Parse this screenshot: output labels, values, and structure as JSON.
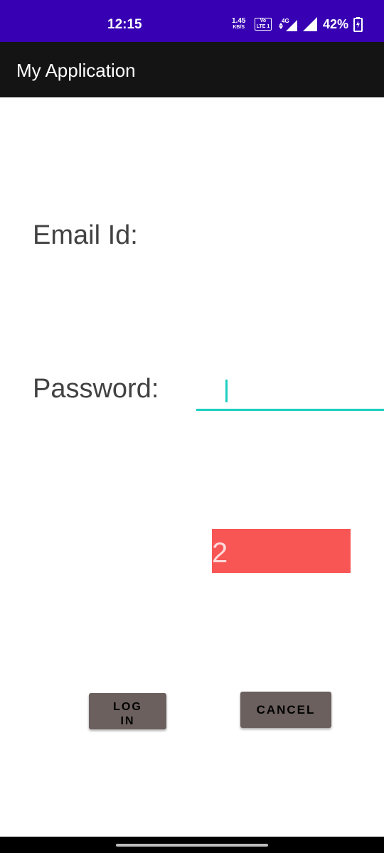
{
  "status_bar": {
    "time": "12:15",
    "net_speed_value": "1.45",
    "net_speed_unit": "KB/S",
    "volte_label": "Vo LTE 1",
    "network_label": "4G",
    "battery_percent": "42%",
    "background_color": "#3700b3"
  },
  "app_bar": {
    "title": "My Application",
    "background_color": "#141414"
  },
  "form": {
    "email_label": "Email Id:",
    "password_label": "Password:",
    "password_value": "",
    "accent_color": "#1ccfc0"
  },
  "red_box": {
    "text": "2",
    "color": "#f85555"
  },
  "buttons": {
    "login": "LOGIN",
    "cancel": "CANCEL",
    "color": "#6b605e"
  },
  "icons": {
    "volte": "volte-icon",
    "signal_4g": "signal-4g-icon",
    "signal": "signal-icon",
    "battery": "battery-charging-icon"
  }
}
